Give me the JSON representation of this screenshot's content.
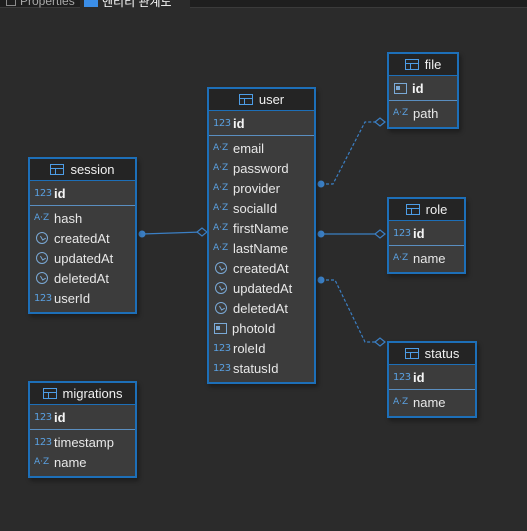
{
  "tabs": [
    {
      "label": "Properties"
    },
    {
      "label": "엔티티 관계도"
    }
  ],
  "entities": {
    "session": {
      "name": "session",
      "pk": [
        {
          "name": "id",
          "type": "123"
        }
      ],
      "fields": [
        {
          "name": "hash",
          "type": "A-Z"
        },
        {
          "name": "createdAt",
          "type": "clock"
        },
        {
          "name": "updatedAt",
          "type": "clock"
        },
        {
          "name": "deletedAt",
          "type": "clock"
        },
        {
          "name": "userId",
          "type": "123"
        }
      ]
    },
    "user": {
      "name": "user",
      "pk": [
        {
          "name": "id",
          "type": "123"
        }
      ],
      "fields": [
        {
          "name": "email",
          "type": "A-Z"
        },
        {
          "name": "password",
          "type": "A-Z"
        },
        {
          "name": "provider",
          "type": "A-Z"
        },
        {
          "name": "socialId",
          "type": "A-Z"
        },
        {
          "name": "firstName",
          "type": "A-Z"
        },
        {
          "name": "lastName",
          "type": "A-Z"
        },
        {
          "name": "createdAt",
          "type": "clock"
        },
        {
          "name": "updatedAt",
          "type": "clock"
        },
        {
          "name": "deletedAt",
          "type": "clock"
        },
        {
          "name": "photoId",
          "type": "card"
        },
        {
          "name": "roleId",
          "type": "123"
        },
        {
          "name": "statusId",
          "type": "123"
        }
      ]
    },
    "file": {
      "name": "file",
      "pk": [
        {
          "name": "id",
          "type": "card"
        }
      ],
      "fields": [
        {
          "name": "path",
          "type": "A-Z"
        }
      ]
    },
    "role": {
      "name": "role",
      "pk": [
        {
          "name": "id",
          "type": "123"
        }
      ],
      "fields": [
        {
          "name": "name",
          "type": "A-Z"
        }
      ]
    },
    "status": {
      "name": "status",
      "pk": [
        {
          "name": "id",
          "type": "123"
        }
      ],
      "fields": [
        {
          "name": "name",
          "type": "A-Z"
        }
      ]
    },
    "migrations": {
      "name": "migrations",
      "pk": [
        {
          "name": "id",
          "type": "123"
        }
      ],
      "fields": [
        {
          "name": "timestamp",
          "type": "123"
        },
        {
          "name": "name",
          "type": "A-Z"
        }
      ]
    }
  },
  "colors": {
    "background": "#2b2b2b",
    "entity_border": "#1d6fb8",
    "entity_body": "#3c3c3c",
    "header": "#242424",
    "connector": "#3b7fc4"
  }
}
